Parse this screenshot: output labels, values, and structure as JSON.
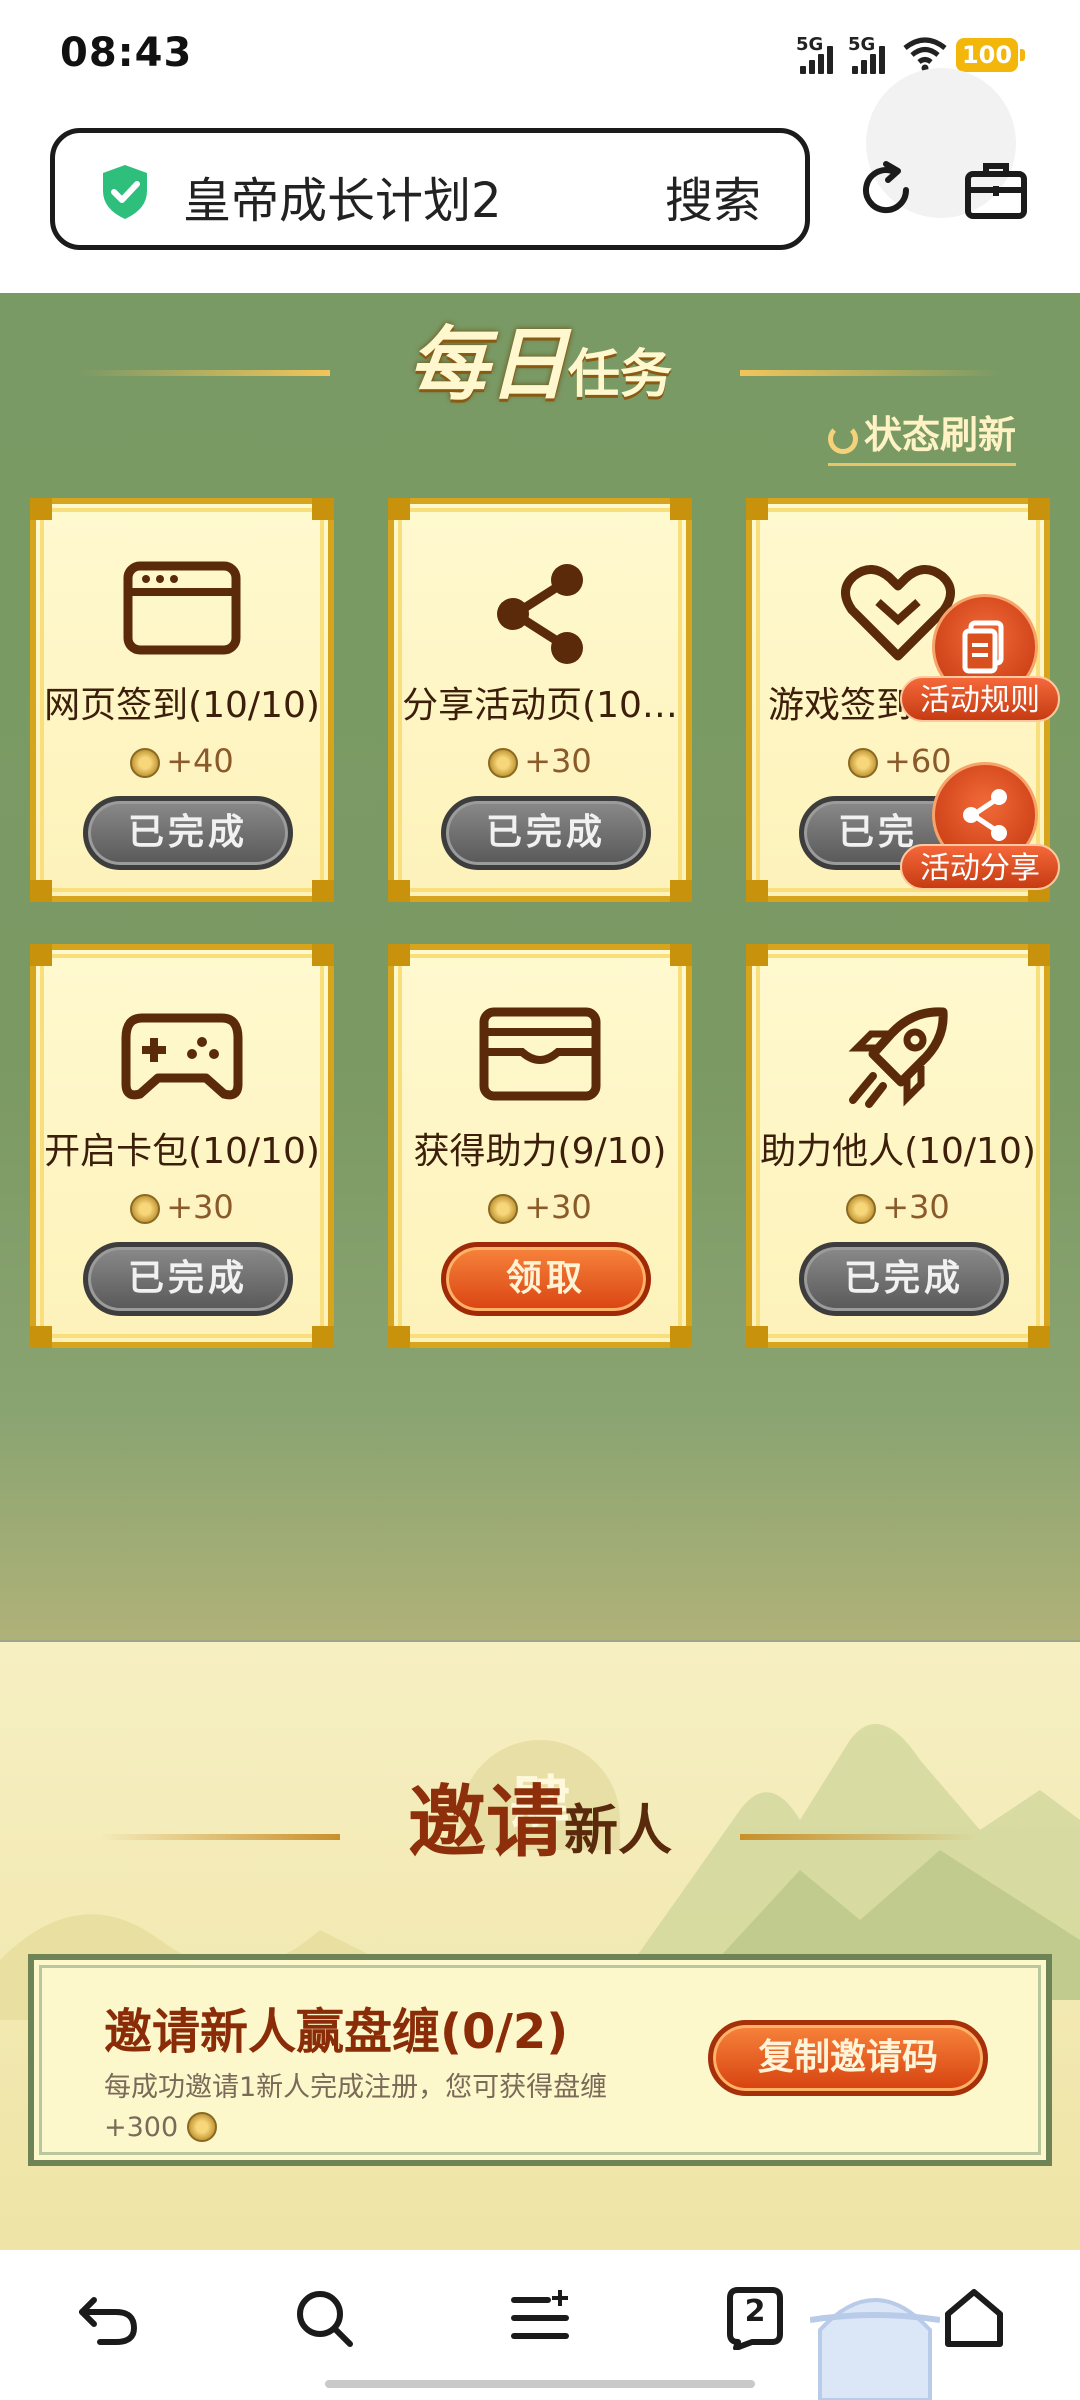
{
  "status_bar": {
    "time": "08:43",
    "signal1": "5G",
    "signal2": "5G",
    "battery": "100"
  },
  "address_bar": {
    "query": "皇帝成长计划2",
    "search_label": "搜索"
  },
  "daily": {
    "title_big": "每日",
    "title_small": "任务",
    "refresh_label": "状态刷新"
  },
  "tasks": [
    {
      "name": "网页签到(10/10)",
      "reward": "+40",
      "button": "已完成",
      "icon": "browser-icon"
    },
    {
      "name": "分享活动页(10…",
      "reward": "+30",
      "button": "已完成",
      "icon": "share-icon"
    },
    {
      "name": "游戏签到",
      "reward": "+60",
      "button": "已完",
      "icon": "heart-handshake-icon"
    },
    {
      "name": "开启卡包(10/10)",
      "reward": "+30",
      "button": "已完成",
      "icon": "gamepad-icon"
    },
    {
      "name": "获得助力(9/10)",
      "reward": "+30",
      "button": "领取",
      "icon": "wallet-icon"
    },
    {
      "name": "助力他人(10/10)",
      "reward": "+30",
      "button": "已完成",
      "icon": "rocket-icon"
    }
  ],
  "floating": {
    "rules": "活动规则",
    "share": "活动分享"
  },
  "invite": {
    "watermark": "肆",
    "title_big": "邀请",
    "title_small": "新人",
    "card_title": "邀请新人赢盘缠(0/2)",
    "card_desc": "每成功邀请1新人完成注册，您可获得盘缠",
    "card_reward": "+300",
    "copy_button": "复制邀请码"
  },
  "bottom_nav": {
    "tabs_count": "2"
  },
  "colors": {
    "accent": "#d94412",
    "gold": "#d6a51d",
    "green": "#7a9a65"
  }
}
